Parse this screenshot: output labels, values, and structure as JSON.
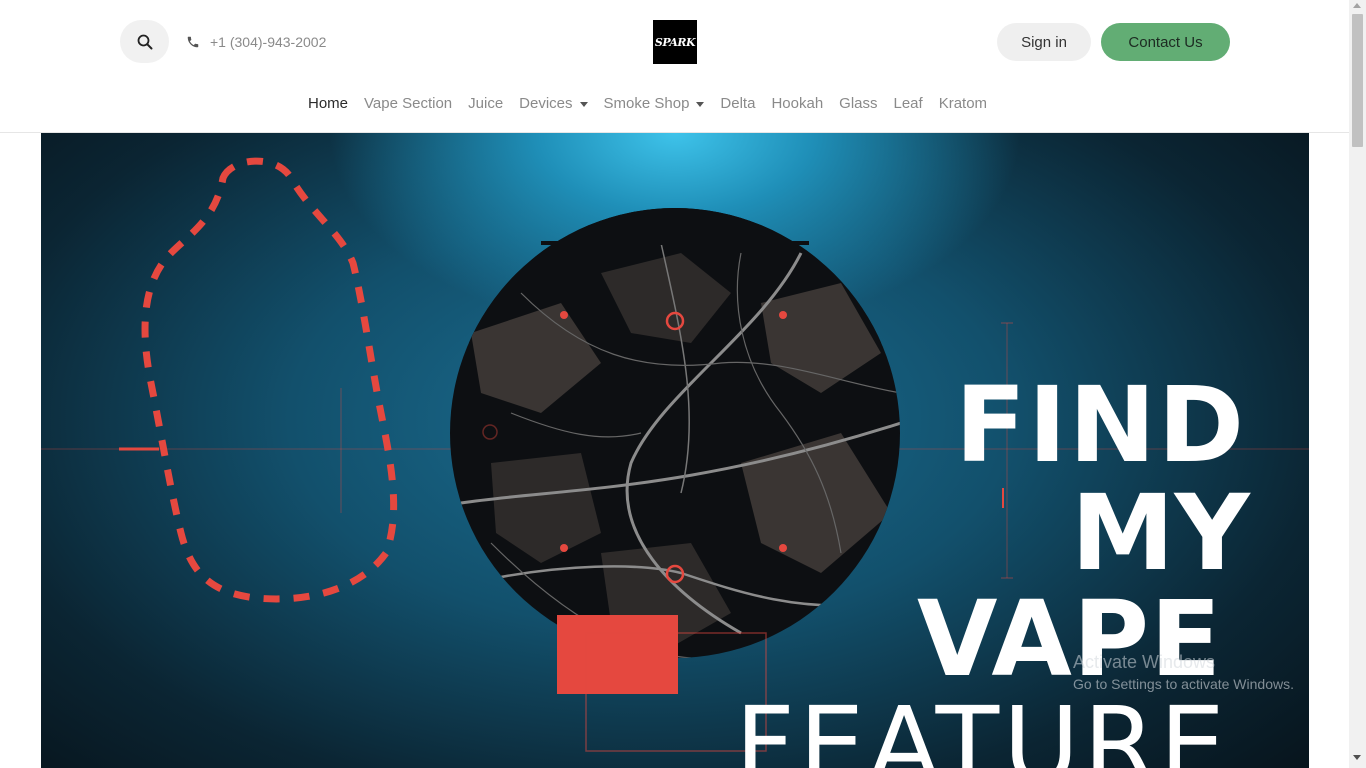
{
  "header": {
    "phone": "+1 (304)-943-2002",
    "logo_text": "SPARK",
    "signin_label": "Sign in",
    "contact_label": "Contact Us",
    "contact_color": "#62ad74"
  },
  "nav": {
    "items": [
      {
        "label": "Home",
        "active": true
      },
      {
        "label": "Vape Section"
      },
      {
        "label": "Juice"
      },
      {
        "label": "Devices",
        "dropdown": true
      },
      {
        "label": "Smoke Shop",
        "dropdown": true
      },
      {
        "label": "Delta"
      },
      {
        "label": "Hookah"
      },
      {
        "label": "Glass"
      },
      {
        "label": "Leaf"
      },
      {
        "label": "Kratom"
      }
    ]
  },
  "hero": {
    "title_lines": [
      "FIND",
      "MY",
      "VAPE",
      "FEATURE"
    ],
    "accent_color": "#e5483f"
  },
  "watermark": {
    "line1": "Activate Windows",
    "line2": "Go to Settings to activate Windows."
  },
  "icons": {
    "search": "search-icon",
    "phone": "phone-icon"
  }
}
